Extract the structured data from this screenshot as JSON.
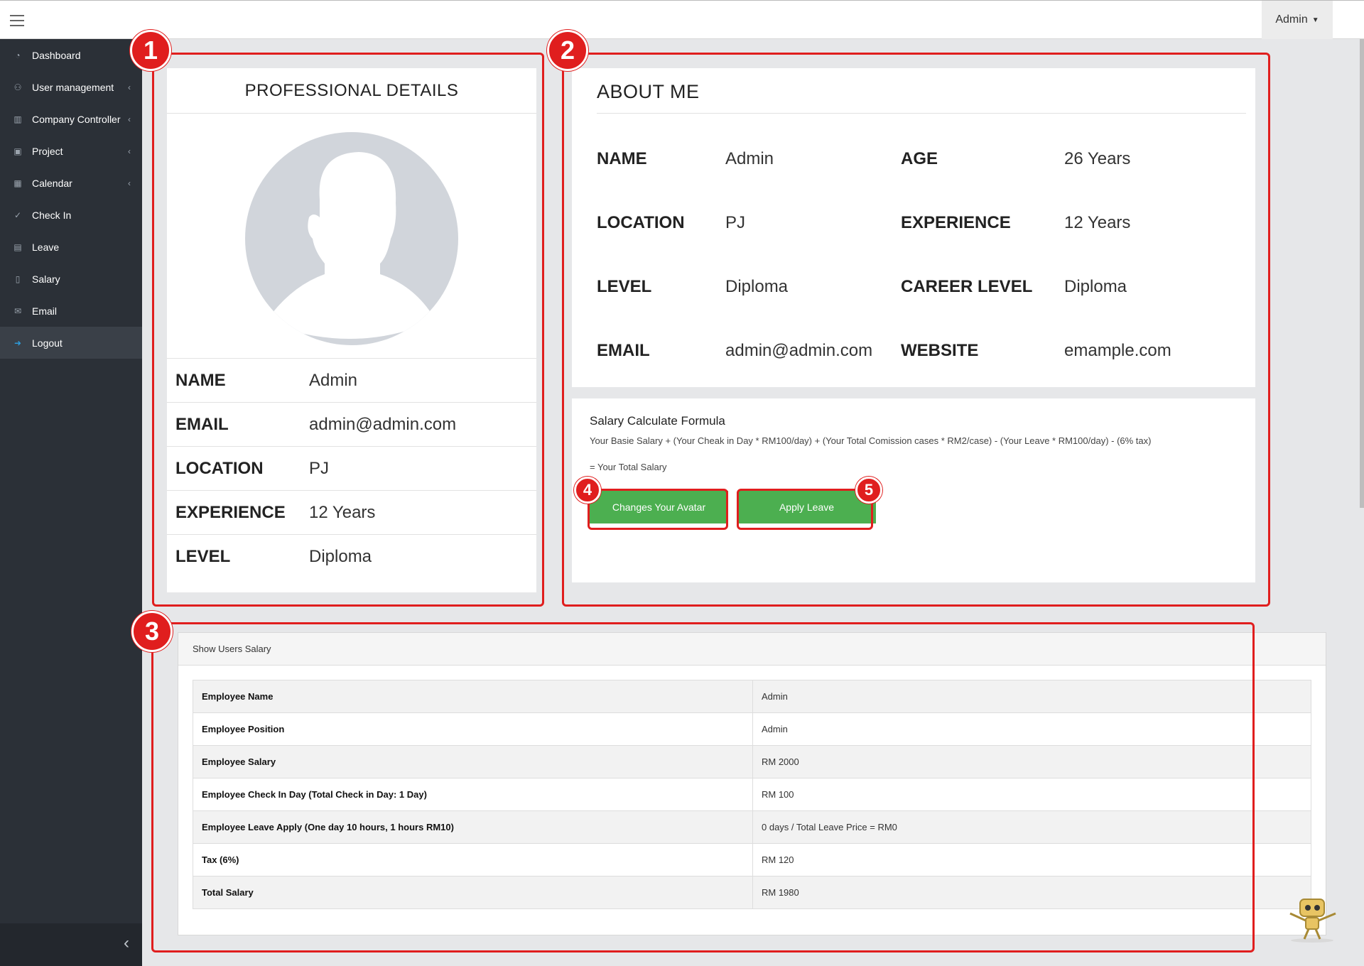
{
  "topbar": {
    "user_menu": "Admin"
  },
  "sidebar": {
    "items": [
      {
        "label": "Dashboard",
        "icon": "dashboard-icon",
        "has_submenu": false
      },
      {
        "label": "User management",
        "icon": "users-icon",
        "has_submenu": true
      },
      {
        "label": "Company Controller",
        "icon": "building-icon",
        "has_submenu": true
      },
      {
        "label": "Project",
        "icon": "project-icon",
        "has_submenu": true
      },
      {
        "label": "Calendar",
        "icon": "calendar-icon",
        "has_submenu": true
      },
      {
        "label": "Check In",
        "icon": "check-icon",
        "has_submenu": false
      },
      {
        "label": "Leave",
        "icon": "leave-icon",
        "has_submenu": false
      },
      {
        "label": "Salary",
        "icon": "salary-icon",
        "has_submenu": false
      },
      {
        "label": "Email",
        "icon": "email-icon",
        "has_submenu": false
      },
      {
        "label": "Logout",
        "icon": "logout-icon",
        "has_submenu": false,
        "active": true
      }
    ]
  },
  "professional": {
    "title": "PROFESSIONAL DETAILS",
    "rows": [
      {
        "key": "NAME",
        "value": "Admin"
      },
      {
        "key": "EMAIL",
        "value": "admin@admin.com"
      },
      {
        "key": "LOCATION",
        "value": "PJ"
      },
      {
        "key": "EXPERIENCE",
        "value": "12 Years"
      },
      {
        "key": "LEVEL",
        "value": "Diploma"
      }
    ]
  },
  "about": {
    "title": "ABOUT ME",
    "left": [
      {
        "key": "NAME",
        "value": "Admin"
      },
      {
        "key": "LOCATION",
        "value": "PJ"
      },
      {
        "key": "LEVEL",
        "value": "Diploma"
      },
      {
        "key": "EMAIL",
        "value": "admin@admin.com"
      }
    ],
    "right": [
      {
        "key": "AGE",
        "value": "26 Years"
      },
      {
        "key": "EXPERIENCE",
        "value": "12 Years"
      },
      {
        "key": "CAREER LEVEL",
        "value": "Diploma"
      },
      {
        "key": "WEBSITE",
        "value": "emample.com"
      }
    ]
  },
  "salary_formula": {
    "title": "Salary Calculate Formula",
    "formula": "Your Basie Salary + (Your Cheak in Day * RM100/day) + (Your Total Comission cases * RM2/case) - (Your Leave * RM100/day) - (6% tax)",
    "result": "= Your Total Salary",
    "avatar_button": "Changes Your Avatar",
    "leave_button": "Apply Leave"
  },
  "users_salary": {
    "heading": "Show Users Salary",
    "rows": [
      {
        "key": "Employee Name",
        "value": "Admin"
      },
      {
        "key": "Employee Position",
        "value": "Admin"
      },
      {
        "key": "Employee Salary",
        "value": "RM 2000"
      },
      {
        "key": "Employee Check In Day (Total Check in Day: 1 Day)",
        "value": "RM 100"
      },
      {
        "key": "Employee Leave Apply (One day 10 hours, 1 hours RM10)",
        "value": "0 days / Total Leave Price = RM0"
      },
      {
        "key": "Tax (6%)",
        "value": "RM 120"
      },
      {
        "key": "Total Salary",
        "value": "RM 1980"
      }
    ]
  },
  "annotations": [
    "1",
    "2",
    "3",
    "4",
    "5"
  ],
  "colors": {
    "sidebar": "#2b3037",
    "button_green": "#4caf50",
    "annotation_red": "#e01e1e"
  }
}
